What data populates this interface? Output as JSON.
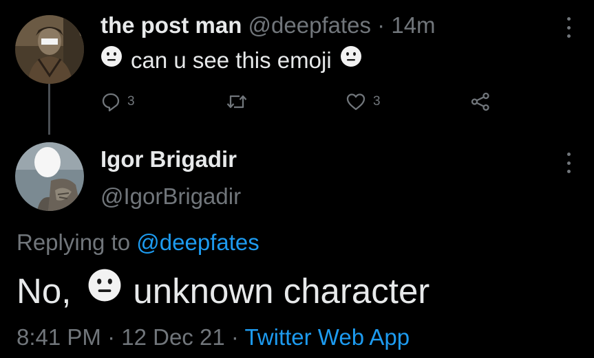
{
  "colors": {
    "background": "#000000",
    "primary_text": "#e7e9ea",
    "secondary_text": "#71767b",
    "link": "#1d9bf0",
    "emoji_face": "#f2f2f2"
  },
  "tweet": {
    "display_name": "the post man",
    "handle": "@deepfates",
    "separator": "·",
    "time_ago": "14m",
    "text": "can u see this emoji",
    "emoji_icon": "neutral-face-emoji-icon",
    "actions": {
      "reply_icon": "reply-icon",
      "reply_count": "3",
      "retweet_icon": "retweet-icon",
      "like_icon": "heart-icon",
      "like_count": "3",
      "share_icon": "share-icon"
    },
    "more_icon": "more-vertical-icon"
  },
  "reply": {
    "display_name": "Igor Brigadir",
    "handle": "@IgorBrigadir",
    "replying_prefix": "Replying to",
    "replying_to": "@deepfates",
    "text_before": "No,",
    "emoji_icon": "neutral-face-emoji-icon",
    "text_after": "unknown character",
    "time": "8:41 PM",
    "separator": "·",
    "date": "12 Dec 21",
    "source": "Twitter Web App",
    "more_icon": "more-vertical-icon"
  }
}
